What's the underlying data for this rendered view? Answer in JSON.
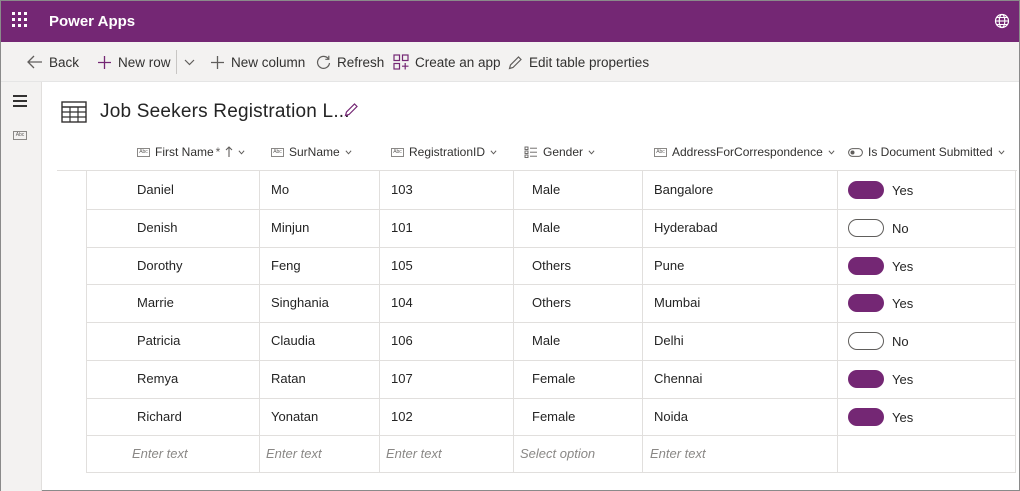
{
  "app": {
    "title": "Power Apps"
  },
  "toolbar": {
    "back": "Back",
    "new_row": "New row",
    "new_column": "New column",
    "refresh": "Refresh",
    "create_app": "Create an app",
    "edit_table": "Edit table properties"
  },
  "table": {
    "title": "Job Seekers Registration L...",
    "columns": {
      "first_name": "First Name",
      "required_mark": "*",
      "surname": "SurName",
      "registration_id": "RegistrationID",
      "gender": "Gender",
      "address": "AddressForCorrespondence",
      "doc_submitted": "Is Document Submitted"
    },
    "rows": [
      {
        "first": "Daniel",
        "surname": "Mo",
        "id": "103",
        "gender": "Male",
        "address": "Bangalore",
        "doc": "Yes"
      },
      {
        "first": "Denish",
        "surname": "Minjun",
        "id": "101",
        "gender": "Male",
        "address": "Hyderabad",
        "doc": "No"
      },
      {
        "first": "Dorothy",
        "surname": "Feng",
        "id": "105",
        "gender": "Others",
        "address": "Pune",
        "doc": "Yes"
      },
      {
        "first": "Marrie",
        "surname": "Singhania",
        "id": "104",
        "gender": "Others",
        "address": "Mumbai",
        "doc": "Yes"
      },
      {
        "first": "Patricia",
        "surname": "Claudia",
        "id": "106",
        "gender": "Male",
        "address": "Delhi",
        "doc": "No"
      },
      {
        "first": "Remya",
        "surname": "Ratan",
        "id": "107",
        "gender": "Female",
        "address": "Chennai",
        "doc": "Yes"
      },
      {
        "first": "Richard",
        "surname": "Yonatan",
        "id": "102",
        "gender": "Female",
        "address": "Noida",
        "doc": "Yes"
      }
    ],
    "new_row_placeholders": {
      "first": "Enter text",
      "surname": "Enter text",
      "id": "Enter text",
      "gender": "Select option",
      "address": "Enter text"
    }
  },
  "icons": {
    "waffle": "waffle-icon",
    "environment": "environment-icon",
    "back": "back-arrow-icon",
    "add": "plus-icon",
    "refresh": "refresh-icon",
    "create_app": "create-app-icon",
    "edit": "pencil-icon",
    "table": "table-icon"
  },
  "colors": {
    "brand": "#742774",
    "toggle_on": "#742774"
  }
}
